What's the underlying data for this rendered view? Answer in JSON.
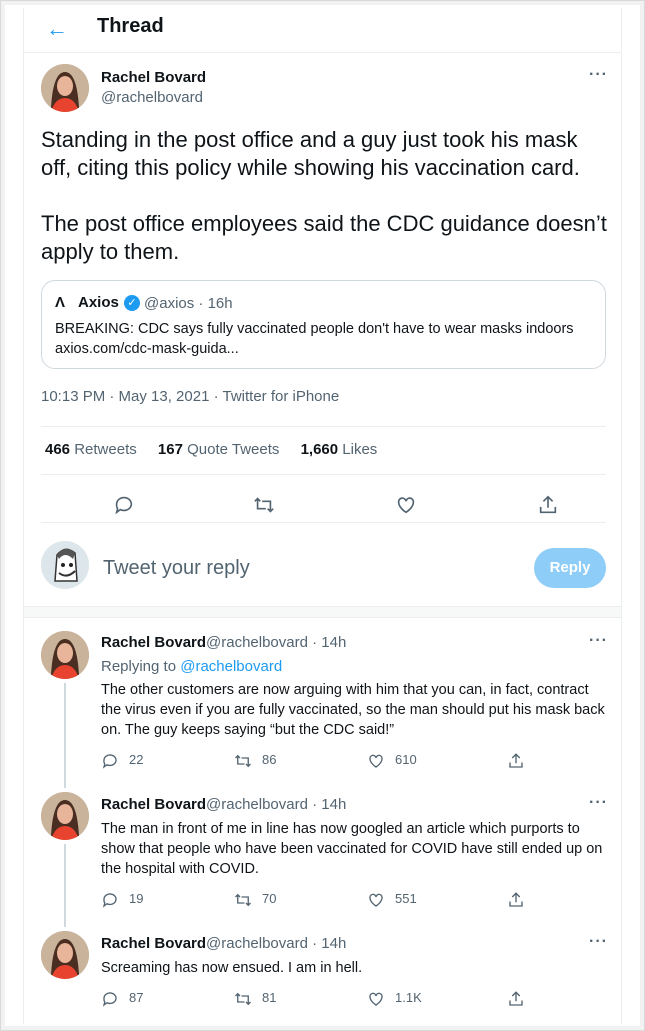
{
  "header": {
    "title": "Thread",
    "back_icon": "arrow-left-icon"
  },
  "tweet": {
    "name": "Rachel Bovard",
    "handle": "@rachelbovard",
    "text": "Standing in the post office and a guy just took his mask off, citing this policy while showing his vaccination card.\n\nThe post office employees said the CDC guidance doesn’t apply to them.",
    "quote": {
      "logo": "Λ",
      "name": "Axios",
      "meta": "@axios · 16h",
      "text": "BREAKING: CDC says fully vaccinated people don't have to wear masks indoors",
      "link": "axios.com/cdc-mask-guida..."
    },
    "timestamp": "10:13 PM · May 13, 2021 · Twitter for iPhone",
    "stats": {
      "retweets_count": "466",
      "retweets_label": "Retweets",
      "quotes_count": "167",
      "quotes_label": "Quote Tweets",
      "likes_count": "1,660",
      "likes_label": "Likes"
    }
  },
  "reply_box": {
    "placeholder": "Tweet your reply",
    "button": "Reply"
  },
  "replies": [
    {
      "name": "Rachel Bovard",
      "handle_time": "@rachelbovard · 14h",
      "replying_prefix": "Replying to ",
      "replying_handle": "@rachelbovard",
      "text": "The other customers are now arguing with him that you can, in fact, contract the virus even if you are fully vaccinated, so the man should put his mask back on. The guy keeps saying “but the CDC said!”",
      "replies": "22",
      "retweets": "86",
      "likes": "610"
    },
    {
      "name": "Rachel Bovard",
      "handle_time": "@rachelbovard · 14h",
      "text": "The man in front of me in line has now googled an article which purports to show that people who have been vaccinated for COVID have still ended up on the hospital with COVID.",
      "replies": "19",
      "retweets": "70",
      "likes": "551"
    },
    {
      "name": "Rachel Bovard",
      "handle_time": "@rachelbovard · 14h",
      "text": "Screaming has now ensued. I am in hell.",
      "replies": "87",
      "retweets": "81",
      "likes": "1.1K"
    }
  ],
  "more_label": "···",
  "colors": {
    "accent": "#1d9bf0",
    "reply_button": "#8ecdf8",
    "secondary_text": "#536471"
  }
}
